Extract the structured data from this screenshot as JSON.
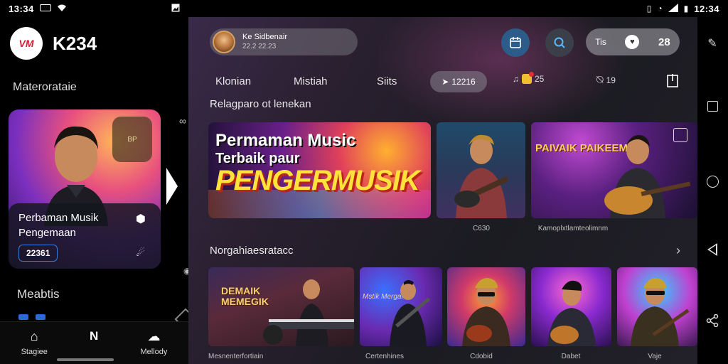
{
  "status_bar": {
    "time_left": "13:34",
    "time_right": "12:34"
  },
  "sidebar": {
    "brand_logo_text": "VM",
    "brand_name": "K234",
    "section_title": "Materorataie",
    "feature_card": {
      "title": "Perbaman Musik Pengemaan",
      "tag": "22361",
      "badge_text": "BP"
    },
    "section_title_2": "Meabtis"
  },
  "bottom_nav": {
    "items": [
      {
        "label": "Stagiee",
        "icon": "home-icon"
      },
      {
        "label": "",
        "icon": "n-logo-icon"
      },
      {
        "label": "Mellody",
        "icon": "chat-bubble-icon"
      }
    ]
  },
  "header": {
    "user_name": "Ke Sidbenair",
    "user_sub": "22.2 22.23",
    "pref_label": "Tis",
    "pref_value": "28"
  },
  "tabs": {
    "items": [
      "Klonian",
      "Mistiah",
      "Siits"
    ],
    "active_pill": "12216",
    "music_count": "25",
    "chat_count": "19"
  },
  "sections": {
    "first_title": "Relagparo ot lenekan",
    "second_title": "Norgahiaesratacc"
  },
  "hero": {
    "line1": "Permaman Music",
    "line2": "Terbaik paur",
    "line3": "PENGERMUSIK"
  },
  "tiles_row1": {
    "t2_title": "PAIVAIK PAIKEEMB",
    "caption1": "C630",
    "caption2": "Kamoplxtlamteolimnm"
  },
  "tiles_row2": {
    "b1_title_1": "DEMAIK",
    "b1_title_2": "MEMEGIK",
    "b2_title": "Mstik Mergak",
    "captions": [
      "Mesnenterfortiain",
      "Certenhines",
      "Cdobid",
      "Dabet",
      "Vaje"
    ]
  },
  "colors": {
    "accent_blue": "#2c5c8a",
    "search_blue": "#5ab8ff",
    "tag_border": "#3b7bd8"
  }
}
